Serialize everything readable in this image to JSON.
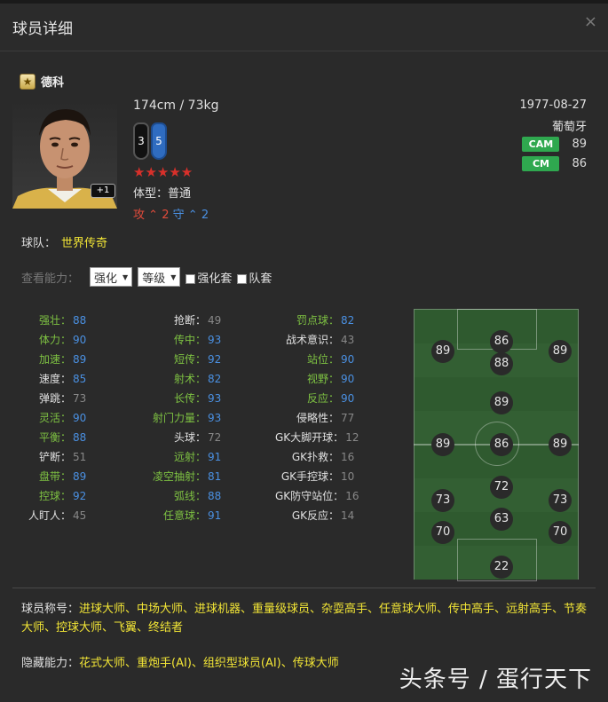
{
  "header": {
    "title": "球员详细",
    "close": "×"
  },
  "player": {
    "name": "德科",
    "height_weight": "174cm / 73kg",
    "weak_foot_left": "3",
    "weak_foot_right": "5",
    "stars": "★★★★★",
    "body_type": "体型：普通",
    "plus_badge": "+1",
    "work_rate": {
      "atk_label": "攻",
      "atk_value": "2",
      "def_label": "守",
      "def_value": "2"
    },
    "birthdate": "1977-08-27",
    "nationality": "葡萄牙",
    "positions": [
      {
        "pos": "CAM",
        "rating": "89"
      },
      {
        "pos": "CM",
        "rating": "86"
      }
    ]
  },
  "team": {
    "label": "球队：",
    "value": "世界传奇"
  },
  "filter": {
    "label": "查看能力：",
    "select1": "强化",
    "select2": "等级",
    "check1": "强化套",
    "check2": "队套"
  },
  "attributes": {
    "col1": [
      {
        "name": "强壮",
        "value": "88",
        "hl": true
      },
      {
        "name": "体力",
        "value": "90",
        "hl": true
      },
      {
        "name": "加速",
        "value": "89",
        "hl": true
      },
      {
        "name": "速度",
        "value": "85",
        "hl": false,
        "blue": true
      },
      {
        "name": "弹跳",
        "value": "73",
        "hl": false
      },
      {
        "name": "灵活",
        "value": "90",
        "hl": true
      },
      {
        "name": "平衡",
        "value": "88",
        "hl": true
      },
      {
        "name": "铲断",
        "value": "51",
        "hl": false
      },
      {
        "name": "盘带",
        "value": "89",
        "hl": true
      },
      {
        "name": "控球",
        "value": "92",
        "hl": true
      },
      {
        "name": "人盯人",
        "value": "45",
        "hl": false
      }
    ],
    "col2": [
      {
        "name": "抢断",
        "value": "49",
        "hl": false
      },
      {
        "name": "传中",
        "value": "93",
        "hl": true
      },
      {
        "name": "短传",
        "value": "92",
        "hl": true
      },
      {
        "name": "射术",
        "value": "82",
        "hl": true
      },
      {
        "name": "长传",
        "value": "93",
        "hl": true
      },
      {
        "name": "射门力量",
        "value": "93",
        "hl": true
      },
      {
        "name": "头球",
        "value": "72",
        "hl": false
      },
      {
        "name": "远射",
        "value": "91",
        "hl": true
      },
      {
        "name": "凌空抽射",
        "value": "81",
        "hl": true
      },
      {
        "name": "弧线",
        "value": "88",
        "hl": true
      },
      {
        "name": "任意球",
        "value": "91",
        "hl": true
      }
    ],
    "col3": [
      {
        "name": "罚点球",
        "value": "82",
        "hl": true
      },
      {
        "name": "战术意识",
        "value": "43",
        "hl": false
      },
      {
        "name": "站位",
        "value": "90",
        "hl": true
      },
      {
        "name": "视野",
        "value": "90",
        "hl": true
      },
      {
        "name": "反应",
        "value": "90",
        "hl": true
      },
      {
        "name": "侵略性",
        "value": "77",
        "hl": false
      },
      {
        "name": "GK大脚开球",
        "value": "12",
        "hl": false
      },
      {
        "name": "GK扑救",
        "value": "16",
        "hl": false
      },
      {
        "name": "GK手控球",
        "value": "10",
        "hl": false
      },
      {
        "name": "GK防守站位",
        "value": "16",
        "hl": false
      },
      {
        "name": "GK反应",
        "value": "14",
        "hl": false
      }
    ]
  },
  "pitch_ratings": {
    "lw": "89",
    "st_top": "86",
    "rw": "89",
    "cf": "88",
    "cam": "89",
    "lm": "89",
    "cm": "86",
    "rm": "89",
    "cdm": "72",
    "lwb": "73",
    "rwb": "73",
    "cb": "63",
    "lb": "70",
    "rb": "70",
    "gk": "22"
  },
  "traits": {
    "label": "球员称号：",
    "value": "进球大师、中场大师、进球机器、重量级球员、杂耍高手、任意球大师、传中高手、远射高手、节奏大师、控球大师、飞翼、终结者"
  },
  "hidden": {
    "label": "隐藏能力：",
    "value": "花式大师、重炮手(AI)、组织型球员(AI)、传球大师"
  },
  "watermark": "头条号 / 蛋行天下",
  "colors": {
    "highlight_green": "#7ec242",
    "value_blue": "#4a90e2",
    "yellow": "#f2e536",
    "badge_green": "#2fa84f",
    "star_red": "#d8302a"
  }
}
